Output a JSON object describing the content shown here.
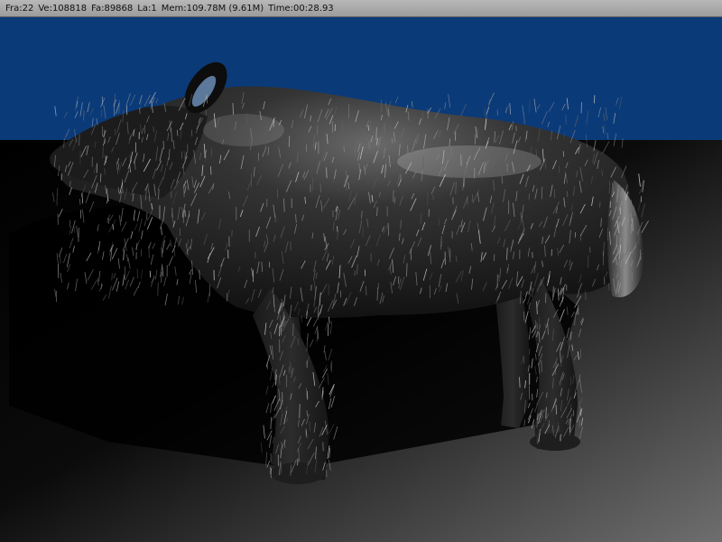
{
  "render_window": {
    "status": {
      "frame": "Fra:22",
      "vertices": "Ve:108818",
      "faces": "Fa:89868",
      "lamps": "La:1",
      "memory": "Mem:109.78M (9.61M)",
      "time": "Time:00:28.93"
    },
    "colors": {
      "sky": "#0b3a78",
      "ground_dark": "#000000",
      "ground_light": "#6e6e6e",
      "status_bar": "#a8a8a8"
    },
    "scene_content": "rendered-furry-boar"
  }
}
